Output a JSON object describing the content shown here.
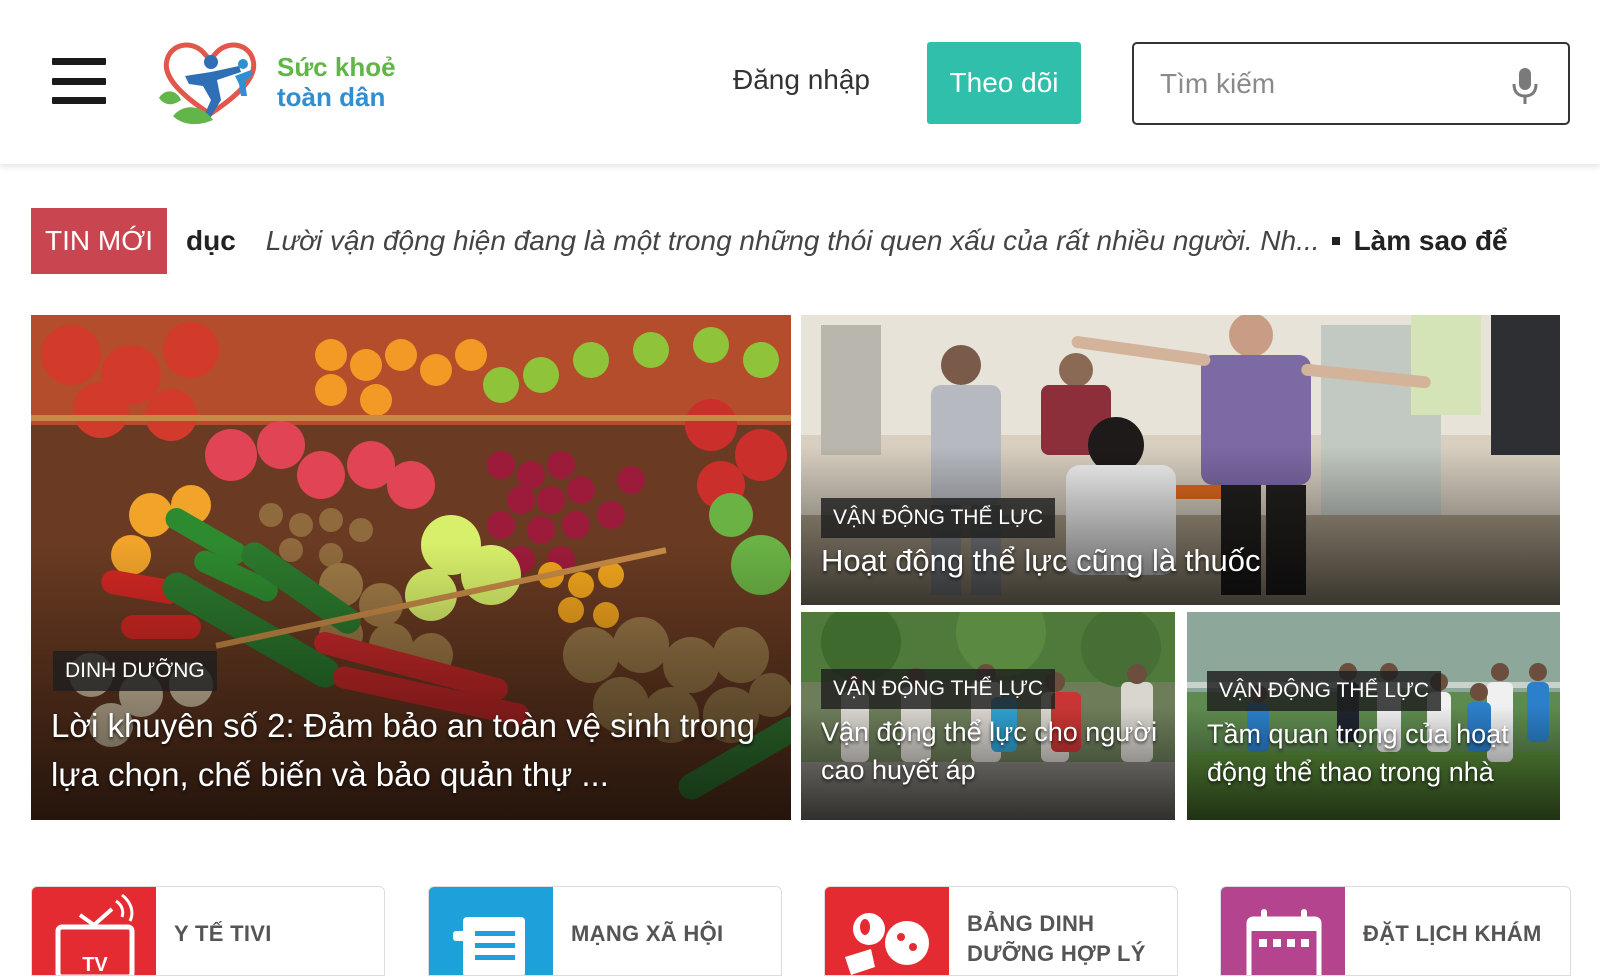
{
  "header": {
    "brand_line1": "Sức khoẻ",
    "brand_line2": "toàn dân",
    "login_label": "Đăng nhập",
    "follow_label": "Theo dõi",
    "search_placeholder": "Tìm kiếm",
    "search_value": ""
  },
  "ticker": {
    "tag": "TIN MỚI",
    "items": [
      {
        "title": "dục",
        "excerpt": "Lười vận động hiện đang là một trong những thói quen xấu của rất nhiều người. Nh..."
      },
      {
        "title": "Làm sao để",
        "excerpt": ""
      }
    ]
  },
  "featured": [
    {
      "category": "DINH DƯỠNG",
      "title": "Lời khuyên số 2: Đảm bảo an toàn vệ sinh trong lựa chọn, chế biến và bảo quản thự ..."
    },
    {
      "category": "VẬN ĐỘNG THỂ LỰC",
      "title": "Hoạt động thể lực cũng là thuốc"
    },
    {
      "category": "VẬN ĐỘNG THỂ LỰC",
      "title": "Vận động thể lực cho người cao huyết áp"
    },
    {
      "category": "VẬN ĐỘNG THỂ LỰC",
      "title": "Tầm quan trọng của hoạt động thể thao trong nhà"
    }
  ],
  "quick_links": [
    {
      "label": "Y TẾ TIVI",
      "icon": "tv-icon",
      "color": "#e42b31"
    },
    {
      "label": "MẠNG XÃ HỘI",
      "icon": "document-icon",
      "color": "#1ea1db"
    },
    {
      "label": "BẢNG DINH DƯỠNG HỢP LÝ",
      "icon": "nutrition-icon",
      "color": "#e42b31"
    },
    {
      "label": "ĐẶT LỊCH KHÁM",
      "icon": "calendar-icon",
      "color": "#b5448f"
    }
  ],
  "colors": {
    "brand_green": "#62b548",
    "brand_blue": "#2f8fd1",
    "follow_button": "#2fbfab",
    "tin_moi_tag": "#c9454f"
  }
}
